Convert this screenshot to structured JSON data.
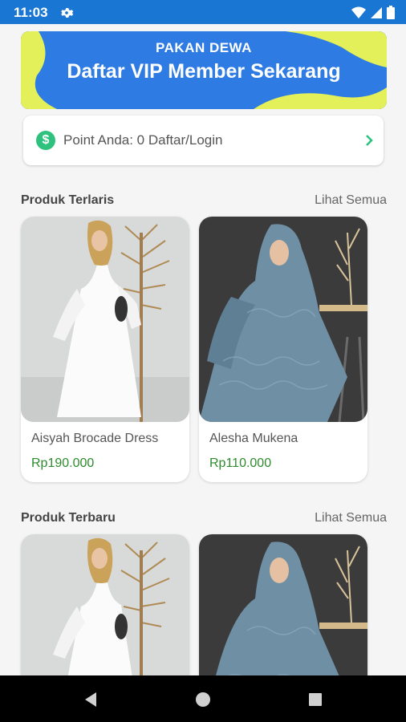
{
  "status": {
    "time": "11:03"
  },
  "banner": {
    "subtitle": "PAKAN DEWA",
    "title": "Daftar VIP Member Sekarang"
  },
  "points": {
    "text": "Point Anda: 0 Daftar/Login"
  },
  "best_sellers": {
    "title": "Produk Terlaris",
    "see_all": "Lihat Semua",
    "products": [
      {
        "name": "Aisyah Brocade Dress",
        "price": "Rp190.000"
      },
      {
        "name": "Alesha Mukena",
        "price": "Rp110.000"
      }
    ]
  },
  "newest": {
    "title": "Produk Terbaru",
    "see_all": "Lihat Semua"
  },
  "colors": {
    "primary": "#1976d2",
    "banner_blue": "#2e7be3",
    "banner_lime": "#e4f05a",
    "price_green": "#2e8b2e",
    "coin_green": "#2ec27e"
  }
}
